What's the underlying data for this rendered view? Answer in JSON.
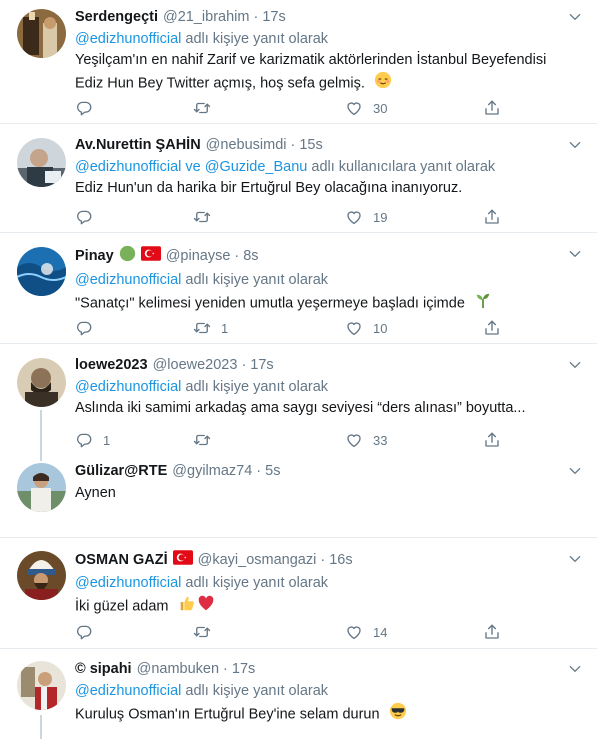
{
  "colors": {
    "link": "#1b95e0",
    "muted": "#657786",
    "text": "#14171a",
    "border": "#e6ecf0"
  },
  "tweets": [
    {
      "name": "Serdengeçti",
      "handle": "@21_ibrahim",
      "time": "17s",
      "reply_mention": "@edizhunofficial",
      "reply_suffix": "adlı kişiye yanıt olarak",
      "text_line1": "Yeşilçam'ın en nahif Zarif ve karizmatik aktörlerinden İstanbul Beyefendisi",
      "text_line2": "Ediz Hun Bey Twitter açmış, hoş sefa gelmiş.",
      "reply_count": "",
      "retweet_count": "",
      "like_count": "30",
      "text_emoji": "relieved-face"
    },
    {
      "name": "Av.Nurettin ŞAHİN",
      "handle": "@nebusimdi",
      "time": "15s",
      "reply_mention": "@edizhunofficial",
      "reply_and": "ve",
      "reply_mention2": "@Guzide_Banu",
      "reply_suffix": "adlı kullanıcılara yanıt olarak",
      "text": "Ediz Hun'un da harika bir Ertuğrul Bey olacağına inanıyoruz.",
      "reply_count": "",
      "retweet_count": "",
      "like_count": "19"
    },
    {
      "name": "Pinay",
      "handle": "@pinayse",
      "time": "8s",
      "header_emojis": [
        "green-circle",
        "turkey-flag"
      ],
      "reply_mention": "@edizhunofficial",
      "reply_suffix": "adlı kişiye yanıt olarak",
      "text": "\"Sanatçı\" kelimesi yeniden umutla yeşermeye başladı içimde",
      "text_emoji": "seedling",
      "reply_count": "",
      "retweet_count": "1",
      "like_count": "10"
    },
    {
      "name": "loewe2023",
      "handle": "@loewe2023",
      "time": "17s",
      "reply_mention": "@edizhunofficial",
      "reply_suffix": "adlı kişiye yanıt olarak",
      "text": "Aslında iki samimi arkadaş ama saygı seviyesi “ders alınası” boyutta...",
      "reply_count": "1",
      "retweet_count": "",
      "like_count": "33"
    },
    {
      "name": "Gülizar@RTE",
      "handle": "@gyilmaz74",
      "time": "5s",
      "text": "Aynen"
    },
    {
      "name": "OSMAN GAZİ",
      "handle": "@kayi_osmangazi",
      "time": "16s",
      "header_emojis": [
        "turkey-flag"
      ],
      "reply_mention": "@edizhunofficial",
      "reply_suffix": "adlı kişiye yanıt olarak",
      "text": "İki güzel adam",
      "text_emojis": [
        "thumbs-up",
        "red-heart"
      ],
      "reply_count": "",
      "retweet_count": "",
      "like_count": "14"
    },
    {
      "name": "sipahi",
      "handle": "@nambuken",
      "time": "17s",
      "name_prefix": "©",
      "reply_mention": "@edizhunofficial",
      "reply_suffix": "adlı kişiye yanıt olarak",
      "text": "Kuruluş Osman'ın Ertuğrul Bey'ine selam durun",
      "text_emoji": "sunglasses-face"
    }
  ]
}
